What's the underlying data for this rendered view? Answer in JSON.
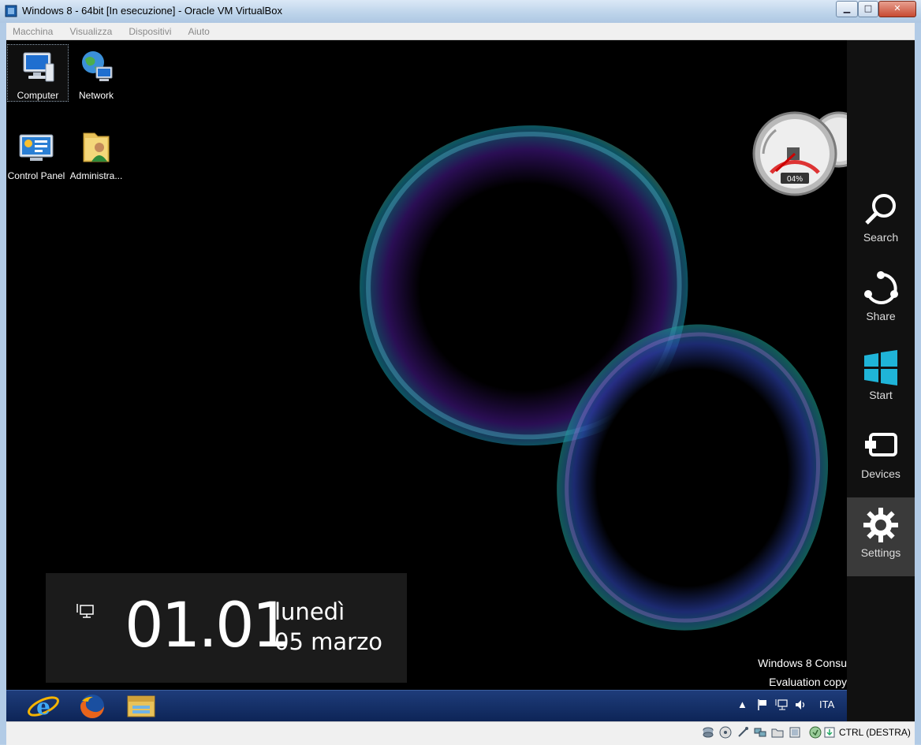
{
  "window": {
    "title": "Windows 8 - 64bit [In esecuzione] - Oracle VM VirtualBox",
    "minimize_label": "▁",
    "maximize_label": "□",
    "close_label": "✕"
  },
  "menubar": {
    "items": [
      {
        "label": "Macchina"
      },
      {
        "label": "Visualizza"
      },
      {
        "label": "Dispositivi"
      },
      {
        "label": "Aiuto"
      }
    ]
  },
  "desktop": {
    "icons": [
      {
        "label": "Computer",
        "icon": "computer-icon"
      },
      {
        "label": "Network",
        "icon": "network-icon"
      },
      {
        "label": "Control Panel",
        "icon": "control-panel-icon"
      },
      {
        "label": "Administra...",
        "icon": "user-folder-icon"
      }
    ],
    "watermark_line1": "Windows 8 Consu",
    "watermark_line2": "Evaluation copy"
  },
  "gadget": {
    "cpu_percent_label": "04%"
  },
  "clock": {
    "time": "01.01",
    "day": "lunedì",
    "date": "05 marzo"
  },
  "charms": [
    {
      "label": "Search",
      "icon": "search-icon"
    },
    {
      "label": "Share",
      "icon": "share-icon"
    },
    {
      "label": "Start",
      "icon": "windows-logo-icon"
    },
    {
      "label": "Devices",
      "icon": "devices-icon"
    },
    {
      "label": "Settings",
      "icon": "gear-icon"
    }
  ],
  "taskbar": {
    "apps": [
      {
        "name": "Internet Explorer",
        "icon": "internet-explorer-icon"
      },
      {
        "name": "Firefox",
        "icon": "firefox-icon"
      },
      {
        "name": "File Explorer",
        "icon": "file-explorer-icon"
      }
    ],
    "tray": {
      "language": "ITA"
    }
  },
  "statusbar": {
    "host_key": "CTRL (DESTRA)"
  },
  "colors": {
    "charms_bg": "#111111",
    "taskbar": "#0d2456",
    "clock_panel": "#1b1b1b"
  }
}
